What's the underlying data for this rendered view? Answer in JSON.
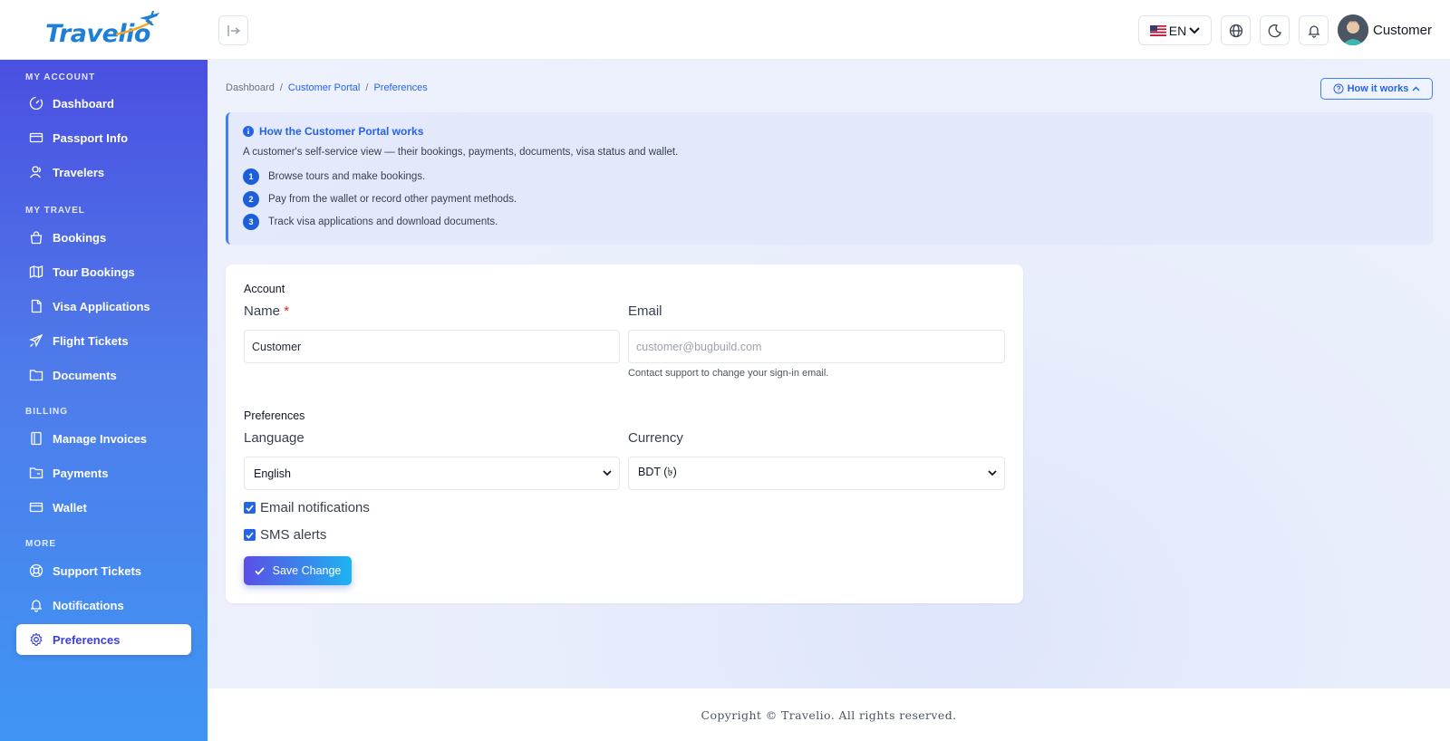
{
  "app": {
    "logo_text": "Travelio"
  },
  "header": {
    "language_code": "EN",
    "user_name": "Customer"
  },
  "sidebar": {
    "sections": [
      {
        "title": "MY ACCOUNT",
        "items": [
          {
            "label": "Dashboard",
            "icon": "gauge-icon"
          },
          {
            "label": "Passport Info",
            "icon": "card-icon"
          },
          {
            "label": "Travelers",
            "icon": "users-icon"
          }
        ]
      },
      {
        "title": "MY TRAVEL",
        "items": [
          {
            "label": "Bookings",
            "icon": "bag-icon"
          },
          {
            "label": "Tour Bookings",
            "icon": "map-icon"
          },
          {
            "label": "Visa Applications",
            "icon": "file-icon"
          },
          {
            "label": "Flight Tickets",
            "icon": "plane-icon"
          },
          {
            "label": "Documents",
            "icon": "folder-icon"
          }
        ]
      },
      {
        "title": "BILLING",
        "items": [
          {
            "label": "Manage Invoices",
            "icon": "invoice-icon"
          },
          {
            "label": "Payments",
            "icon": "wallet-folder-icon"
          },
          {
            "label": "Wallet",
            "icon": "wallet-icon"
          }
        ]
      },
      {
        "title": "MORE",
        "items": [
          {
            "label": "Support Tickets",
            "icon": "lifebuoy-icon"
          },
          {
            "label": "Notifications",
            "icon": "bell-icon"
          },
          {
            "label": "Preferences",
            "icon": "gear-icon",
            "active": true
          }
        ]
      }
    ]
  },
  "breadcrumb": {
    "items": [
      "Dashboard",
      "Customer Portal",
      "Preferences"
    ]
  },
  "how_button_label": "How it works",
  "info": {
    "title": "How the Customer Portal works",
    "description": "A customer's self-service view — their bookings, payments, documents, visa status and wallet.",
    "steps": [
      {
        "num": "1",
        "text": "Browse tours and make bookings."
      },
      {
        "num": "2",
        "text": "Pay from the wallet or record other payment methods."
      },
      {
        "num": "3",
        "text": "Track visa applications and download documents."
      }
    ]
  },
  "form": {
    "account_section": "Account",
    "name_label": "Name",
    "name_required": "*",
    "name_value": "Customer",
    "email_label": "Email",
    "email_value": "customer@bugbuild.com",
    "email_help": "Contact support to change your sign-in email.",
    "preferences_section": "Preferences",
    "language_label": "Language",
    "language_value": "English",
    "currency_label": "Currency",
    "currency_value": "BDT (৳)",
    "email_notifications_label": "Email notifications",
    "email_notifications_checked": true,
    "sms_alerts_label": "SMS alerts",
    "sms_alerts_checked": true,
    "save_label": "Save Change"
  },
  "footer": {
    "copyright": "Copyright © Travelio. All rights reserved."
  },
  "colors": {
    "accent": "#2563eb",
    "sidebar_top": "#4a4fe0",
    "sidebar_bottom": "#3f95f4"
  }
}
